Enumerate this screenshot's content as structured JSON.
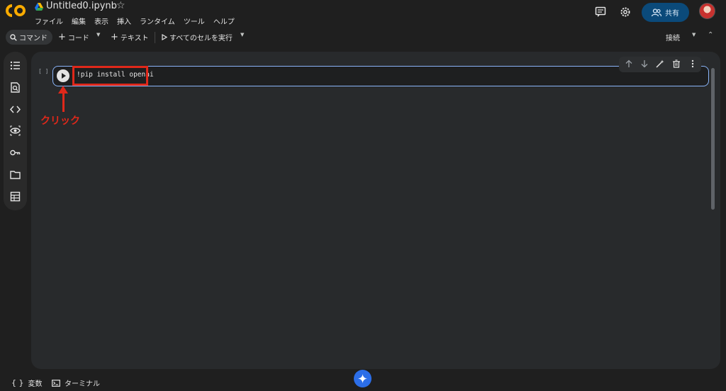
{
  "app": {
    "file_title": "Untitled0.ipynb",
    "menu": [
      "ファイル",
      "編集",
      "表示",
      "挿入",
      "ランタイム",
      "ツール",
      "ヘルプ"
    ],
    "share_label": "共有"
  },
  "toolbar": {
    "command_label": "コマンド",
    "add_code_label": "コード",
    "add_text_label": "テキスト",
    "run_all_label": "すべてのセルを実行",
    "connect_label": "接続"
  },
  "cell": {
    "bracket": "[ ]",
    "code": "!pip install openai"
  },
  "annotation": {
    "label": "クリック",
    "color": "#e0281a"
  },
  "footer": {
    "variables_label": "変数",
    "terminal_label": "ターミナル"
  },
  "colors": {
    "accent": "#8ab4f8",
    "share_bg": "#0b4a7a",
    "background": "#1f1f1f",
    "panel": "#282a2c"
  }
}
